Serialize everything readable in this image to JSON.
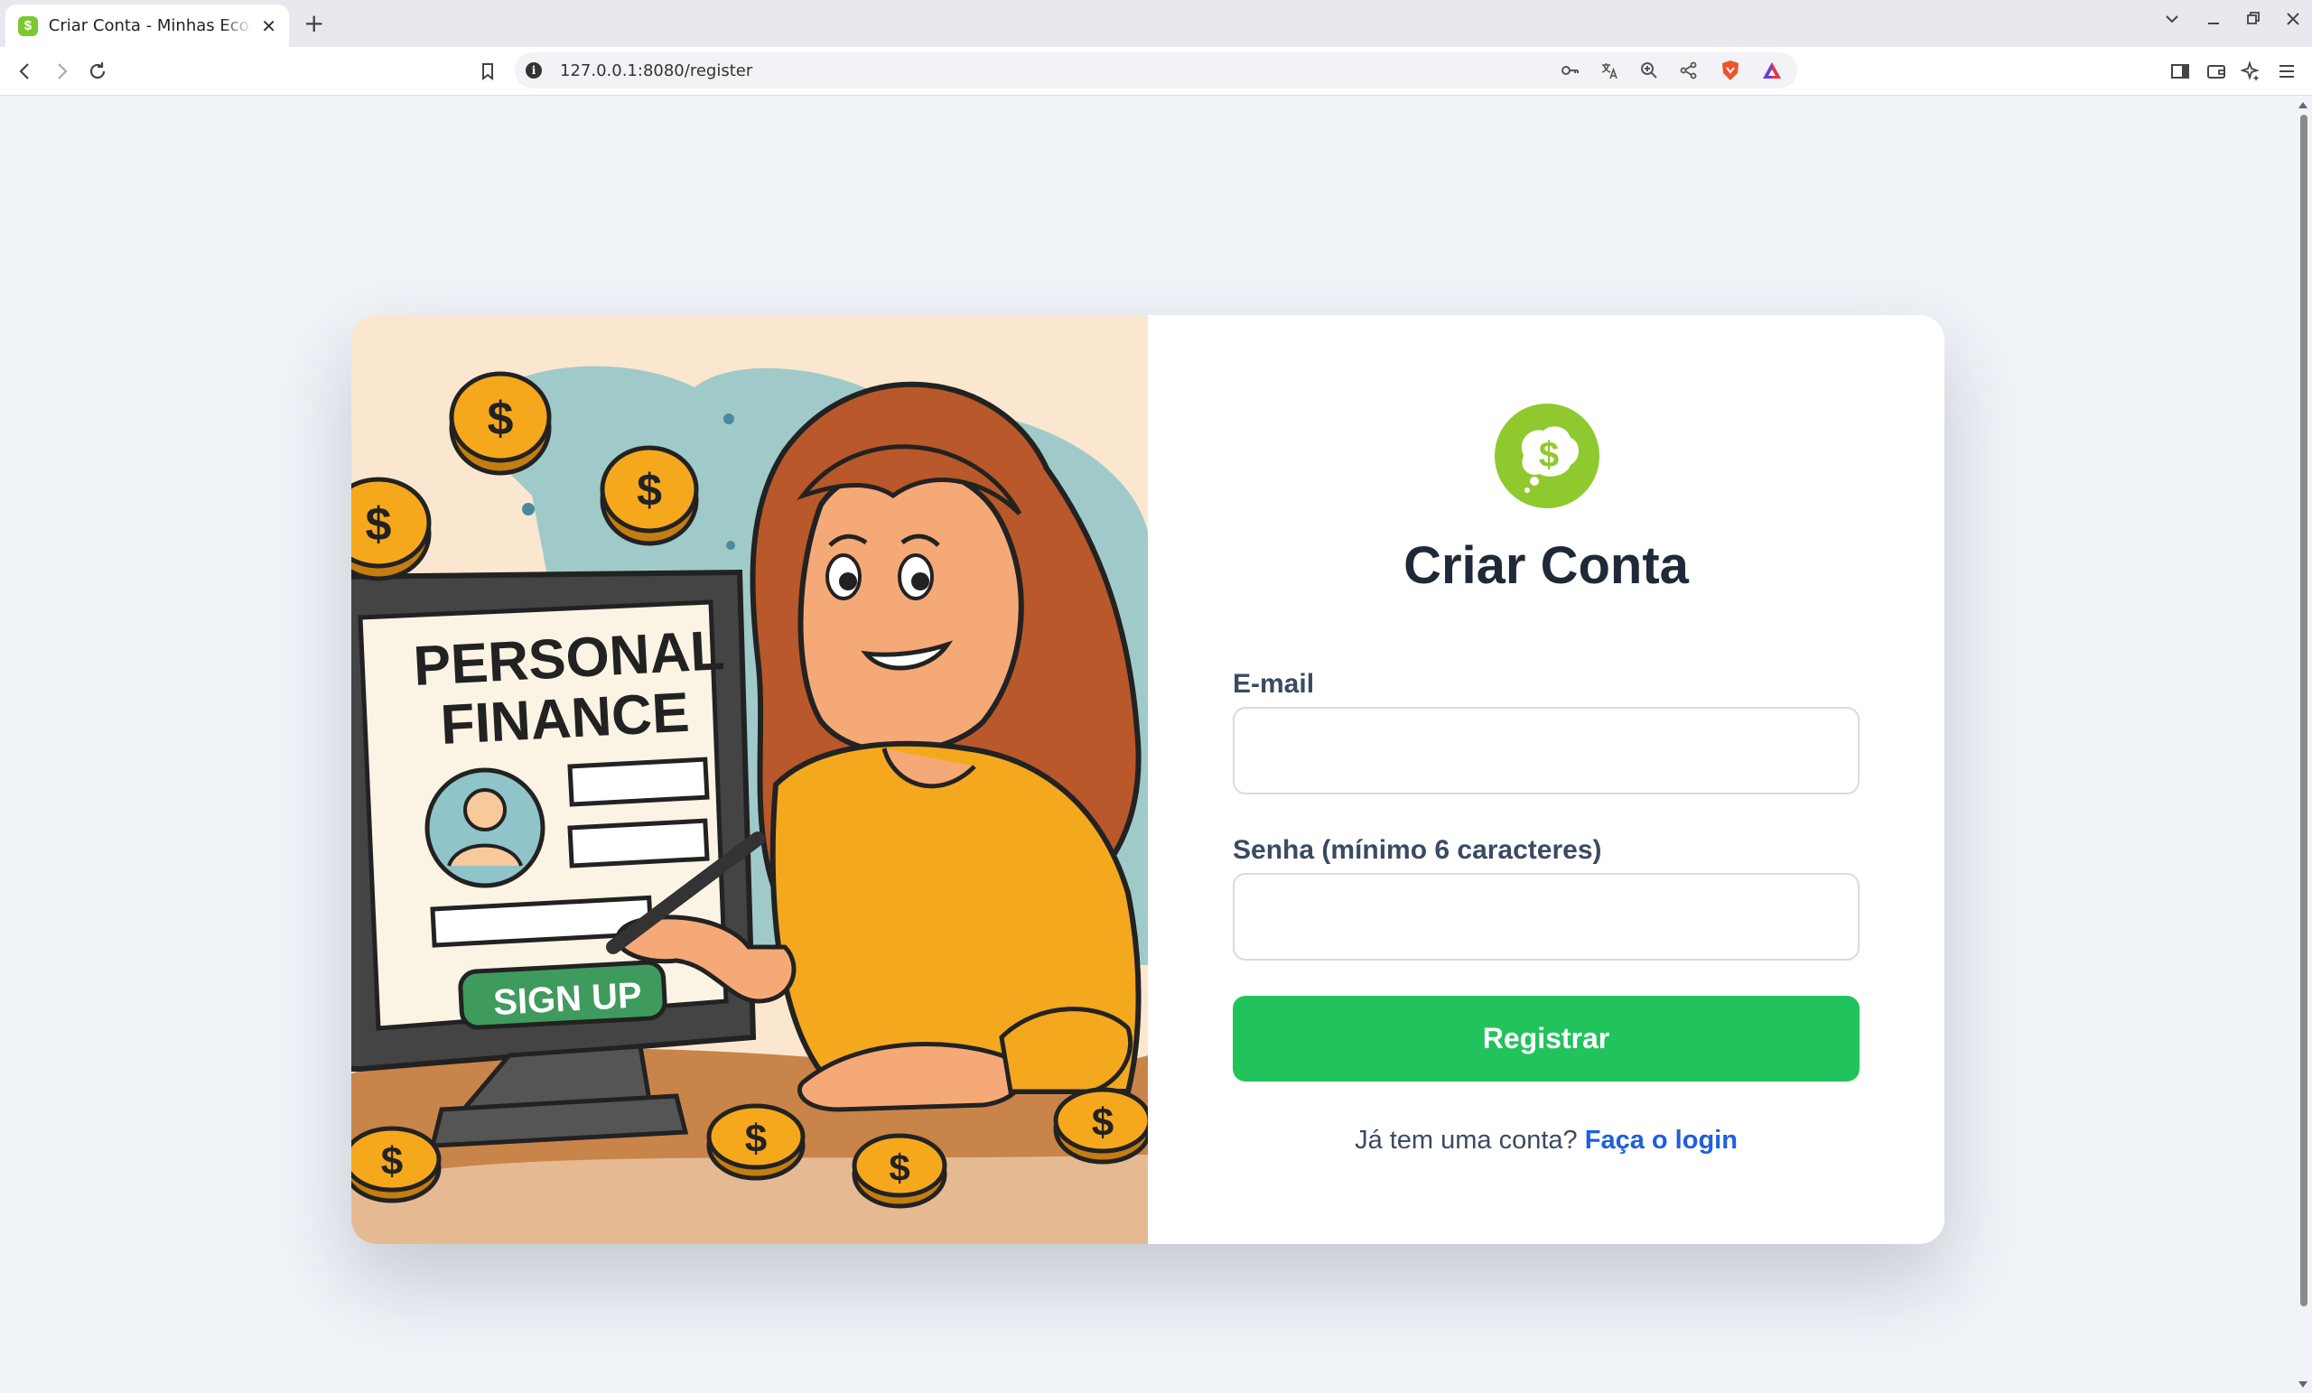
{
  "browser": {
    "tab_title": "Criar Conta - Minhas Economias",
    "tab_close": "✕",
    "new_tab": "+",
    "url": "127.0.0.1:8080/register",
    "accent": "#e7e9ee"
  },
  "illustration": {
    "screen_line1": "PERSONAL",
    "screen_line2": "FINANCE",
    "screen_button": "SIGN UP",
    "coin_symbol": "$"
  },
  "form": {
    "logo_symbol": "$",
    "title": "Criar Conta",
    "email_label": "E-mail",
    "email_value": "",
    "password_label": "Senha (mínimo 6 caracteres)",
    "password_value": "",
    "submit_label": "Registrar",
    "footer_text": "Já tem uma conta?",
    "footer_link": "Faça o login"
  },
  "colors": {
    "primary_button": "#22c35c",
    "link": "#1d5fe0",
    "logo": "#8fc92e",
    "page_bg": "#f0f3f8"
  }
}
